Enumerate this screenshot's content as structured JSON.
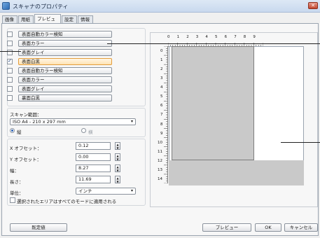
{
  "window": {
    "title": "スキャナのプロパティ",
    "close_glyph": "✕"
  },
  "tabs": [
    {
      "label": "画像"
    },
    {
      "label": "用紙"
    },
    {
      "label": "プレビュー"
    },
    {
      "label": "設定"
    },
    {
      "label": "情報"
    }
  ],
  "image_modes": [
    {
      "label": "表面自動カラー検知",
      "checked": false
    },
    {
      "label": "表面カラー",
      "checked": false
    },
    {
      "label": "表面グレイ",
      "checked": false
    },
    {
      "label": "表面白黒",
      "checked": true
    },
    {
      "label": "表面自動カラー検知",
      "checked": false
    },
    {
      "label": "表面カラー",
      "checked": false
    },
    {
      "label": "表面グレイ",
      "checked": false
    },
    {
      "label": "裏面白黒",
      "checked": false
    }
  ],
  "scan_area": {
    "label": "スキャン範囲：",
    "value": "ISO A4 - 210 x 297 mm",
    "orientation_portrait": "縦",
    "orientation_landscape": "横"
  },
  "fields": {
    "x_offset": {
      "label": "X オフセット：",
      "value": "0.12"
    },
    "y_offset": {
      "label": "Y オフセット：",
      "value": "0.00"
    },
    "width": {
      "label": "幅：",
      "value": "8.27"
    },
    "length": {
      "label": "長さ：",
      "value": "11.69"
    },
    "unit": {
      "label": "単位：",
      "value": "インチ"
    },
    "apply_all": "選択されたエリアはすべてのモードに適用される"
  },
  "ruler": {
    "top_labels": [
      "0",
      "1",
      "2",
      "3",
      "4",
      "5",
      "6",
      "7",
      "8",
      "9"
    ],
    "left_labels": [
      "0",
      "1",
      "2",
      "3",
      "4",
      "5",
      "6",
      "7",
      "8",
      "9",
      "10",
      "11",
      "12",
      "13",
      "14"
    ]
  },
  "buttons": {
    "default": "既定値",
    "preview": "プレビュー",
    "ok": "OK",
    "cancel": "キャンセル"
  },
  "icons": {
    "dropdown": "▾",
    "spin_up": "▲",
    "spin_down": "▼"
  }
}
